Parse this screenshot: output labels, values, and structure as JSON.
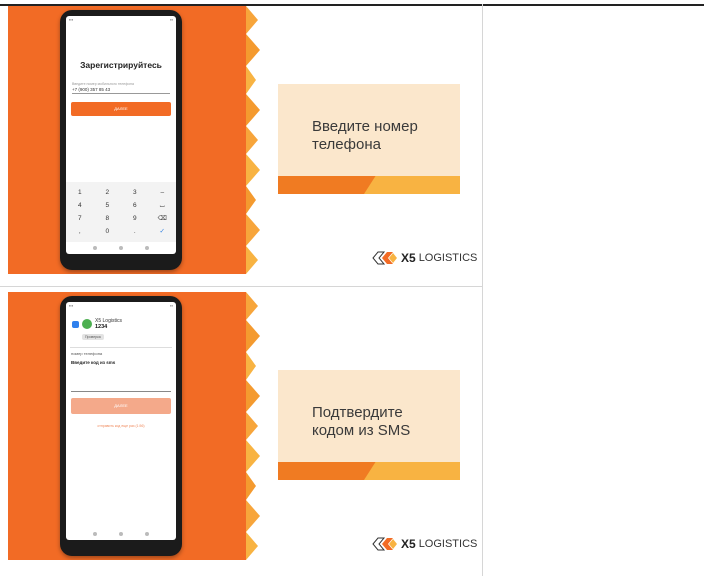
{
  "slides": [
    {
      "phone_title": "Зарегистрируйтесь",
      "phone_hint": "Введите номер мобильного телефона",
      "phone_value": "+7 (900) 357 85 43",
      "phone_button": "ДАЛЕЕ",
      "keypad": [
        [
          "1",
          "2",
          "3",
          "–"
        ],
        [
          "4",
          "5",
          "6",
          "⌴"
        ],
        [
          "7",
          "8",
          "9",
          "⌫"
        ],
        [
          ",",
          "0",
          ".",
          "✓"
        ]
      ],
      "caption_line1": "Введите номер",
      "caption_line2": "телефона",
      "logo_x5": "X5",
      "logo_word": "LOGISTICS"
    },
    {
      "contact_name": "X5 Logistics",
      "contact_number": "1234",
      "chip": "Проверка",
      "field_label": "номер телефона",
      "prompt": "Введите код из sms",
      "phone_button": "ДАЛЕЕ",
      "resend_link": "отправить код еще раз (1:56)",
      "caption_line1": "Подтвердите",
      "caption_line2": "кодом из SMS",
      "logo_x5": "X5",
      "logo_word": "LOGISTICS"
    }
  ],
  "colors": {
    "orange": "#f26b25",
    "peach": "#fbe7cc",
    "amber": "#f8b342"
  }
}
